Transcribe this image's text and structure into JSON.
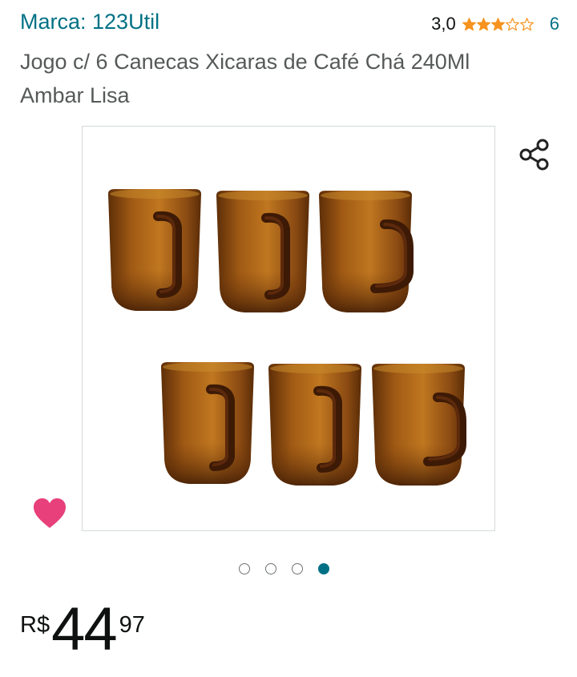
{
  "product": {
    "brand_label": "Marca: 123Util",
    "rating": {
      "value": "3,0",
      "stars_out_of_5": 3,
      "count": "6",
      "star_color": "#f7931e"
    },
    "title": "Jogo c/ 6 Canecas Xicaras de Café Chá 240Ml Ambar Lisa",
    "image": {
      "content": "six-amber-glass-mugs",
      "mug_color": "#8a4a12"
    },
    "gallery": {
      "dots": 4,
      "active_index": 3
    },
    "price": {
      "symbol": "R$",
      "whole": "44",
      "fraction": "97"
    }
  },
  "colors": {
    "link": "#007185",
    "heart": "#e8407a",
    "text": "#0f1111",
    "title_text": "#565959"
  }
}
